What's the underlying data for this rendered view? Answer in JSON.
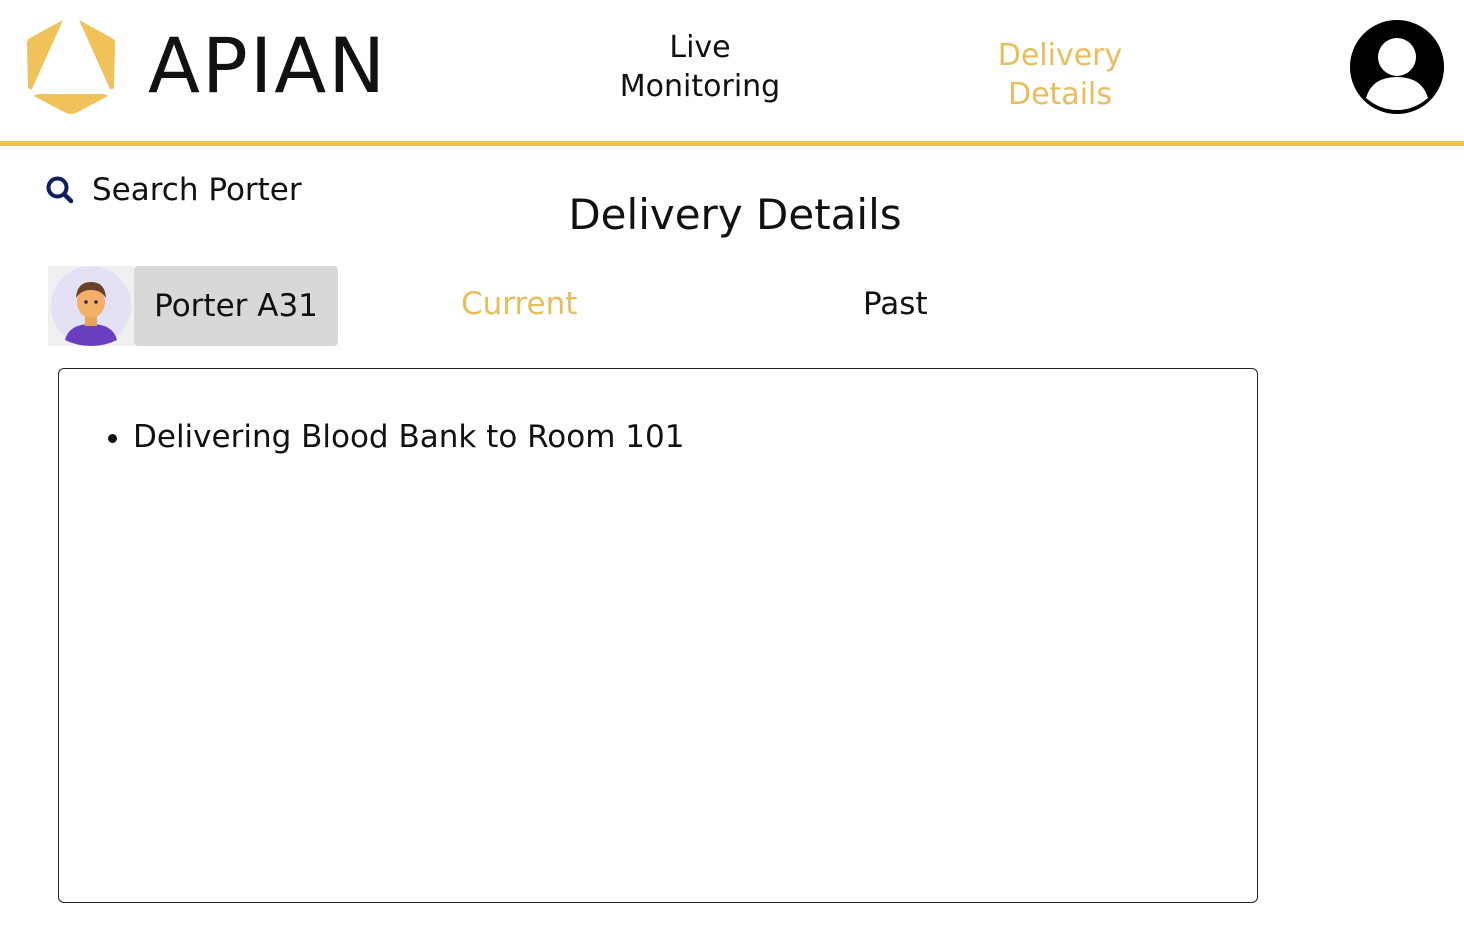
{
  "header": {
    "brand": "APIAN",
    "nav": {
      "live_line1": "Live",
      "live_line2": "Monitoring",
      "delivery_line1": "Delivery",
      "delivery_line2": "Details"
    },
    "icons": {
      "logo": "apian-logo-icon",
      "profile": "user-profile-icon"
    }
  },
  "search": {
    "label": "Search Porter",
    "icon": "search-icon"
  },
  "main": {
    "title": "Delivery Details",
    "porter": {
      "name": "Porter A31",
      "avatar": "porter-avatar-icon"
    },
    "tabs": {
      "current": "Current",
      "past": "Past",
      "active": "Current"
    },
    "deliveries": {
      "items": [
        "Delivering Blood Bank to Room 101"
      ]
    }
  },
  "colors": {
    "accent": "#EBC05D",
    "active_tab": "#E9BD5B",
    "search_icon": "#0F1E5C",
    "text": "#111111"
  }
}
